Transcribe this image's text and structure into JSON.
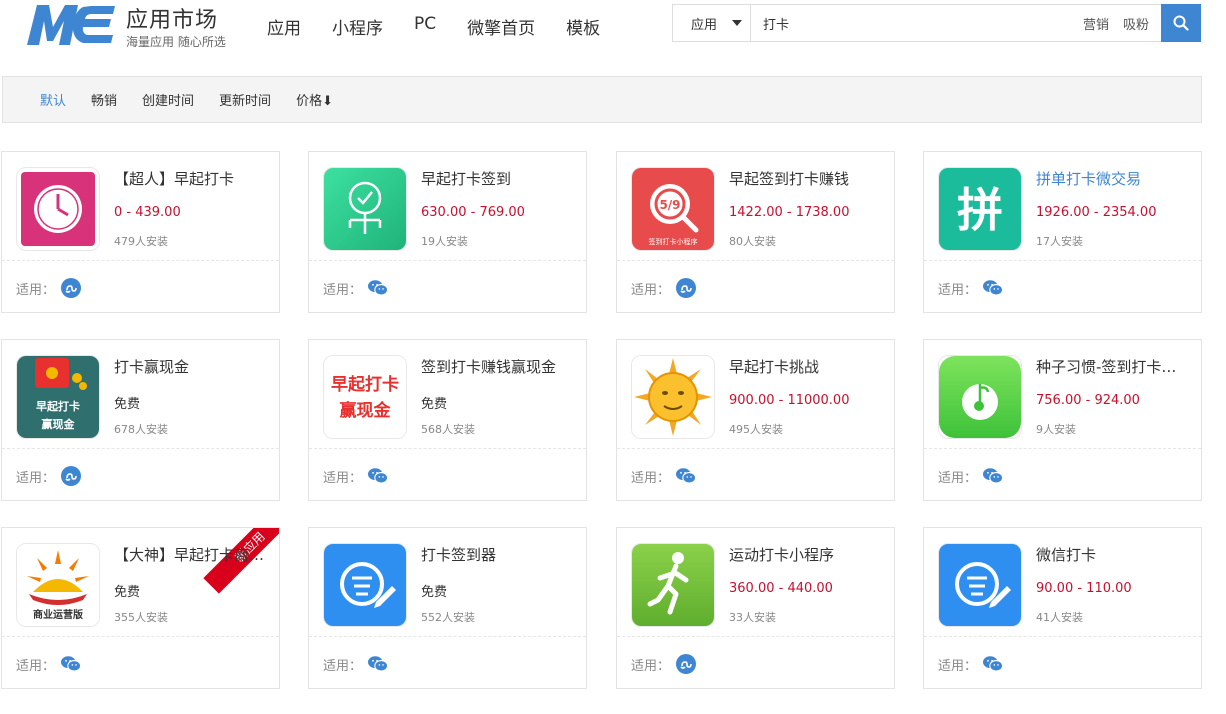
{
  "header": {
    "brand_title": "应用市场",
    "brand_subtitle": "海量应用 随心所选",
    "nav": [
      "应用",
      "小程序",
      "PC",
      "微擎首页",
      "模板"
    ]
  },
  "search": {
    "category": "应用",
    "value": "打卡",
    "hot_links": [
      "营销",
      "吸粉"
    ]
  },
  "filters": [
    {
      "label": "默认",
      "active": true
    },
    {
      "label": "畅销",
      "active": false
    },
    {
      "label": "创建时间",
      "active": false
    },
    {
      "label": "更新时间",
      "active": false
    },
    {
      "label": "价格⬇",
      "active": false
    }
  ],
  "labels": {
    "suitable": "适用：",
    "new_badge": "新应用"
  },
  "colors": {
    "accent": "#3f86d2",
    "price": "#c8102e",
    "badge": "#d9001b"
  },
  "apps": [
    {
      "title": "【超人】早起打卡",
      "price": "0 - 439.00",
      "installs": "479人安装",
      "platform": "miniprogram-icon",
      "icon": "clock-icon",
      "free": false,
      "blue": false,
      "badge": false
    },
    {
      "title": "早起打卡签到",
      "price": "630.00 - 769.00",
      "installs": "19人安装",
      "platform": "wechat-icon",
      "icon": "checkin-person-icon",
      "free": false,
      "blue": false,
      "badge": false
    },
    {
      "title": "早起签到打卡赚钱",
      "price": "1422.00 - 1738.00",
      "installs": "80人安装",
      "platform": "miniprogram-icon",
      "icon": "magnifier-icon",
      "free": false,
      "blue": false,
      "badge": false
    },
    {
      "title": "拼单打卡微交易",
      "price": "1926.00 - 2354.00",
      "installs": "17人安装",
      "platform": "wechat-icon",
      "icon": "pin-char-icon",
      "free": false,
      "blue": true,
      "badge": false
    },
    {
      "title": "打卡赢现金",
      "price": "免费",
      "installs": "678人安装",
      "platform": "miniprogram-icon",
      "icon": "redpacket-icon",
      "free": true,
      "blue": false,
      "badge": false
    },
    {
      "title": "签到打卡赚钱赢现金",
      "price": "免费",
      "installs": "568人安装",
      "platform": "wechat-icon",
      "icon": "text-logo-icon",
      "free": true,
      "blue": false,
      "badge": false
    },
    {
      "title": "早起打卡挑战",
      "price": "900.00 - 11000.00",
      "installs": "495人安装",
      "platform": "wechat-icon",
      "icon": "sun-face-icon",
      "free": false,
      "blue": false,
      "badge": false
    },
    {
      "title": "种子习惯-签到打卡小程序",
      "price": "756.00 - 924.00",
      "installs": "9人安装",
      "platform": "wechat-icon",
      "icon": "seed-icon",
      "free": false,
      "blue": false,
      "badge": false
    },
    {
      "title": "【大神】早起打卡商业运营版",
      "price": "免费",
      "installs": "355人安装",
      "platform": "wechat-icon",
      "icon": "sunrise-icon",
      "free": true,
      "blue": false,
      "badge": true
    },
    {
      "title": "打卡签到器",
      "price": "免费",
      "installs": "552人安装",
      "platform": "wechat-icon",
      "icon": "sign-pen-icon",
      "free": true,
      "blue": false,
      "badge": false
    },
    {
      "title": "运动打卡小程序",
      "price": "360.00 - 440.00",
      "installs": "33人安装",
      "platform": "miniprogram-icon",
      "icon": "runner-icon",
      "free": false,
      "blue": false,
      "badge": false
    },
    {
      "title": "微信打卡",
      "price": "90.00 - 110.00",
      "installs": "41人安装",
      "platform": "wechat-icon",
      "icon": "sign-pen-icon",
      "free": false,
      "blue": false,
      "badge": false
    }
  ],
  "icon_texts": {
    "pin": "拼",
    "redpacket_line1": "早起打卡",
    "redpacket_line2": "赢现金",
    "text_logo_line1": "早起打卡",
    "text_logo_line2": "赢现金",
    "magnifier_num": "5/9",
    "magnifier_caption": "签到打卡小程序",
    "sunrise_caption": "商业运营版"
  }
}
